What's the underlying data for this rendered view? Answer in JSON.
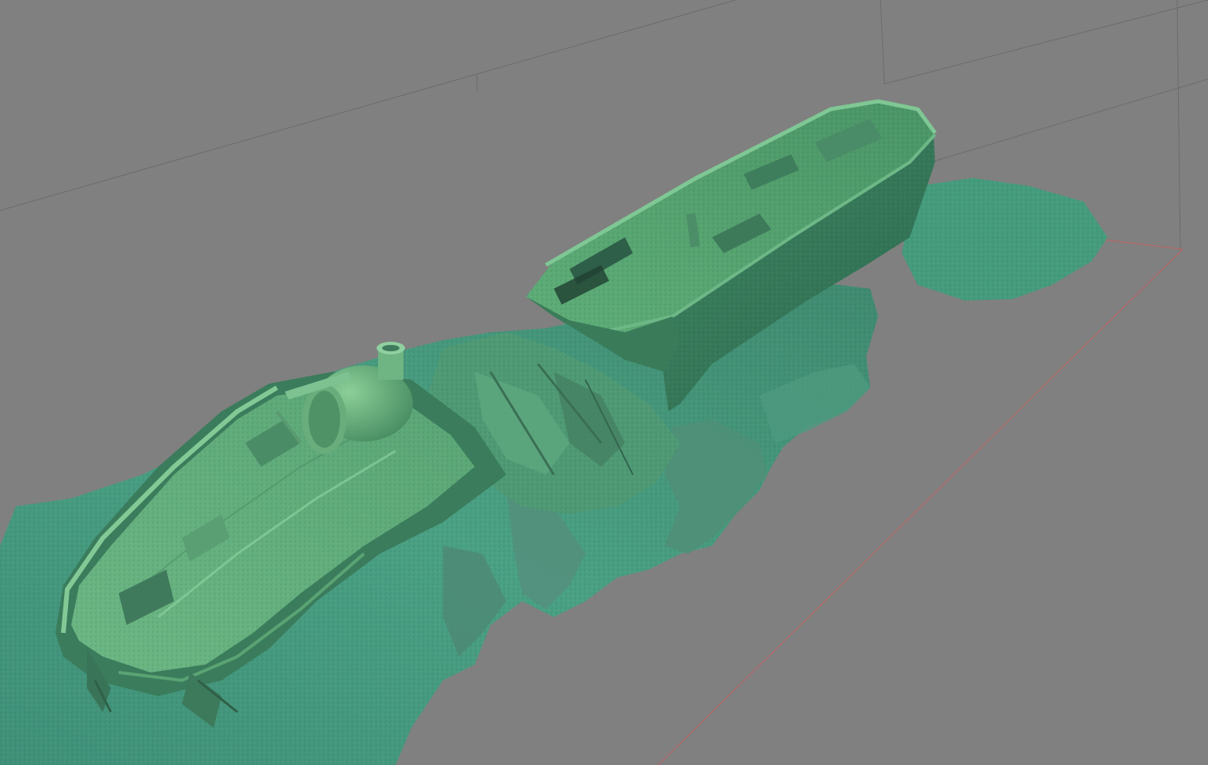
{
  "viewport": {
    "background_color": "#808080",
    "bounding_box_color": "#6b6b6b",
    "axis_x_color": "#c06060"
  },
  "model": {
    "palette": {
      "deep": "#2e6b57",
      "mid": "#3f8f6c",
      "light": "#6fbf86",
      "highlight": "#9ad8a0",
      "shadow": "#1f4a3b",
      "hull_side": "#3a7a5c",
      "hull_dark": "#2a5a46",
      "seabed": "#4a9a80",
      "seabed_light": "#5fb090"
    }
  }
}
